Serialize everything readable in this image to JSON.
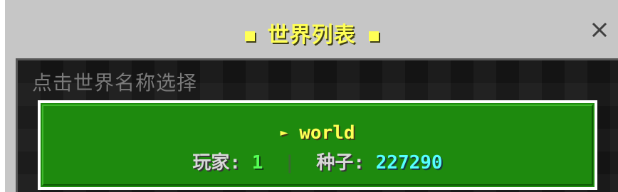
{
  "window": {
    "title": "世界列表",
    "close_label": "×"
  },
  "content": {
    "hint": "点击世界名称选择"
  },
  "worlds": [
    {
      "arrow": "►",
      "name": "world",
      "players_label": "玩家:",
      "players": "1",
      "separator": "|",
      "seed_label": "种子:",
      "seed": "227290"
    }
  ],
  "colors": {
    "title": "#ffff55",
    "entry_background": "#1e8a0e",
    "players_value": "#55ff55",
    "seed_value": "#55ffff",
    "hint": "#7a7a7a"
  },
  "icons": {
    "close": "close-icon",
    "title_decoration": "square-icon",
    "selection_arrow": "arrow-right-icon"
  }
}
